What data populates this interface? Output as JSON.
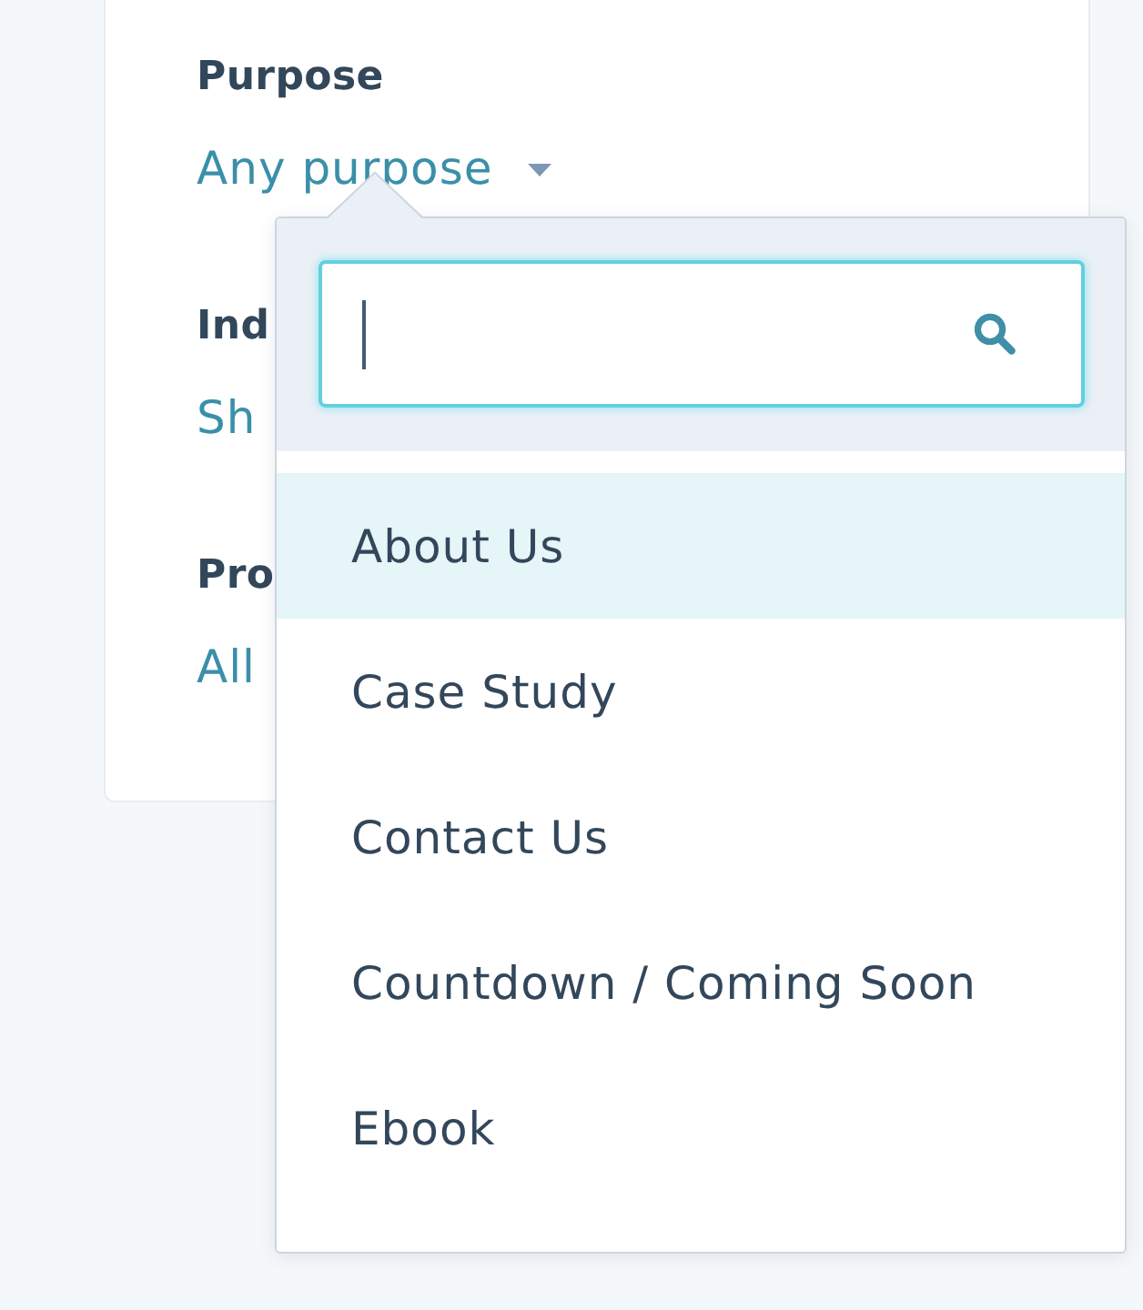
{
  "filters": [
    {
      "label": "Purpose",
      "value": "Any purpose",
      "caret": true
    },
    {
      "label": "Ind",
      "value": "Sh",
      "caret": false
    },
    {
      "label": "Pro",
      "value": "All",
      "caret": false
    }
  ],
  "dropdown": {
    "search": {
      "focused": true
    },
    "options": [
      {
        "label": "About Us",
        "selected": true
      },
      {
        "label": "Case Study",
        "selected": false
      },
      {
        "label": "Contact Us",
        "selected": false
      },
      {
        "label": "Countdown / Coming Soon",
        "selected": false
      },
      {
        "label": "Ebook",
        "selected": false
      }
    ]
  }
}
